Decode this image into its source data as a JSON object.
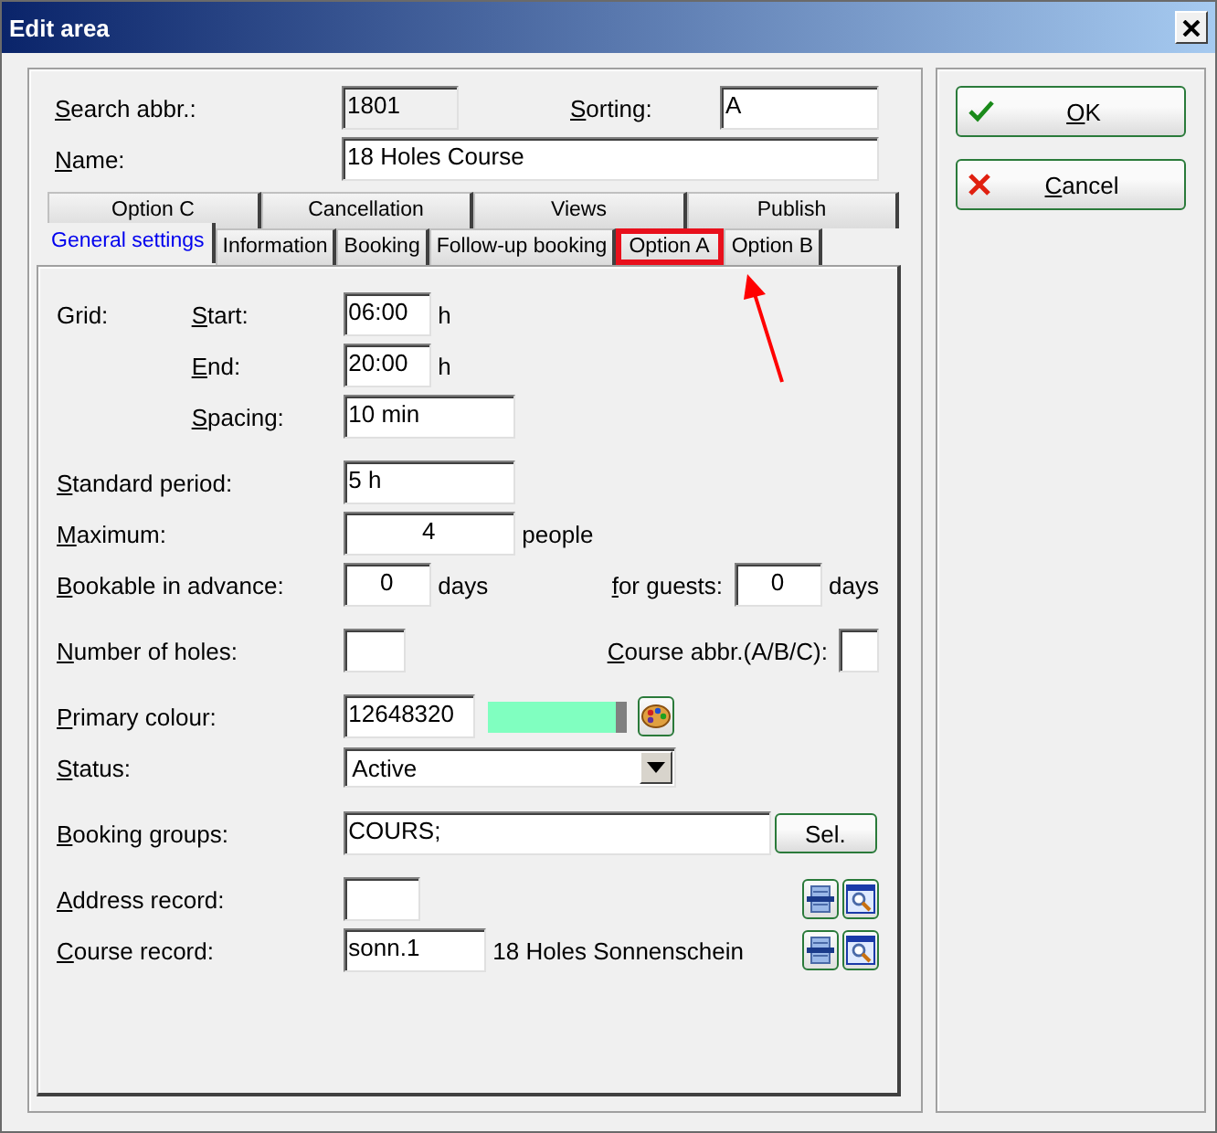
{
  "window": {
    "title": "Edit area"
  },
  "header": [
    {
      "label": "Search abbr.:",
      "value": "1801",
      "disabled": true
    },
    {
      "label": "Sorting:",
      "value": "A",
      "disabled": false
    },
    {
      "label": "Name:",
      "value": "18 Holes Course",
      "disabled": false
    }
  ],
  "tab_rows": [
    [
      {
        "label": "Option C",
        "selected": false,
        "highlighted": false
      },
      {
        "label": "Cancellation",
        "selected": false,
        "highlighted": false
      },
      {
        "label": "Views",
        "selected": false,
        "highlighted": false
      },
      {
        "label": "Publish",
        "selected": false,
        "highlighted": false
      }
    ],
    [
      {
        "label": "General settings",
        "selected": true,
        "highlighted": false
      },
      {
        "label": "Information",
        "selected": false,
        "highlighted": false
      },
      {
        "label": "Booking",
        "selected": false,
        "highlighted": false
      },
      {
        "label": "Follow-up booking",
        "selected": false,
        "highlighted": false
      },
      {
        "label": "Option A",
        "selected": false,
        "highlighted": true
      },
      {
        "label": "Option B",
        "selected": false,
        "highlighted": false
      }
    ]
  ],
  "sections": [
    [
      {
        "kind": "sub",
        "group": "Grid:",
        "label": "Start:",
        "value": "06:00",
        "unit": "h"
      },
      {
        "kind": "sub",
        "label": "End:",
        "value": "20:00",
        "unit": "h"
      },
      {
        "kind": "sub",
        "label": "Spacing:",
        "value": "10 min"
      }
    ],
    [
      {
        "kind": "field",
        "label": "Standard period:",
        "value": "5 h"
      },
      {
        "kind": "count",
        "label": "Maximum:",
        "value": "4",
        "unit": "people"
      },
      {
        "kind": "count",
        "label": "Bookable in advance:",
        "value": "0",
        "unit": "days",
        "second": {
          "label": "for guests:",
          "value": "0",
          "unit": "days"
        }
      }
    ],
    [
      {
        "kind": "field",
        "label": "Number of holes:",
        "second": {
          "label": "Course abbr.(A/B/C):"
        }
      }
    ],
    [
      {
        "kind": "colour",
        "label": "Primary colour:",
        "value": "12648320",
        "color": "#80ffc0"
      },
      {
        "kind": "dropdown",
        "label": "Status:",
        "value": "Active"
      }
    ],
    [
      {
        "kind": "select",
        "label": "Booking groups:",
        "value": "COURS;",
        "button": "Sel."
      }
    ],
    [
      {
        "kind": "record",
        "label": "Address record:"
      },
      {
        "kind": "record",
        "label": "Course record:",
        "value": "sonn.1",
        "description": "18 Holes Sonnenschein"
      }
    ]
  ],
  "buttons": [
    {
      "kind": "ok",
      "label": "OK"
    },
    {
      "kind": "cancel",
      "label": "Cancel"
    }
  ]
}
